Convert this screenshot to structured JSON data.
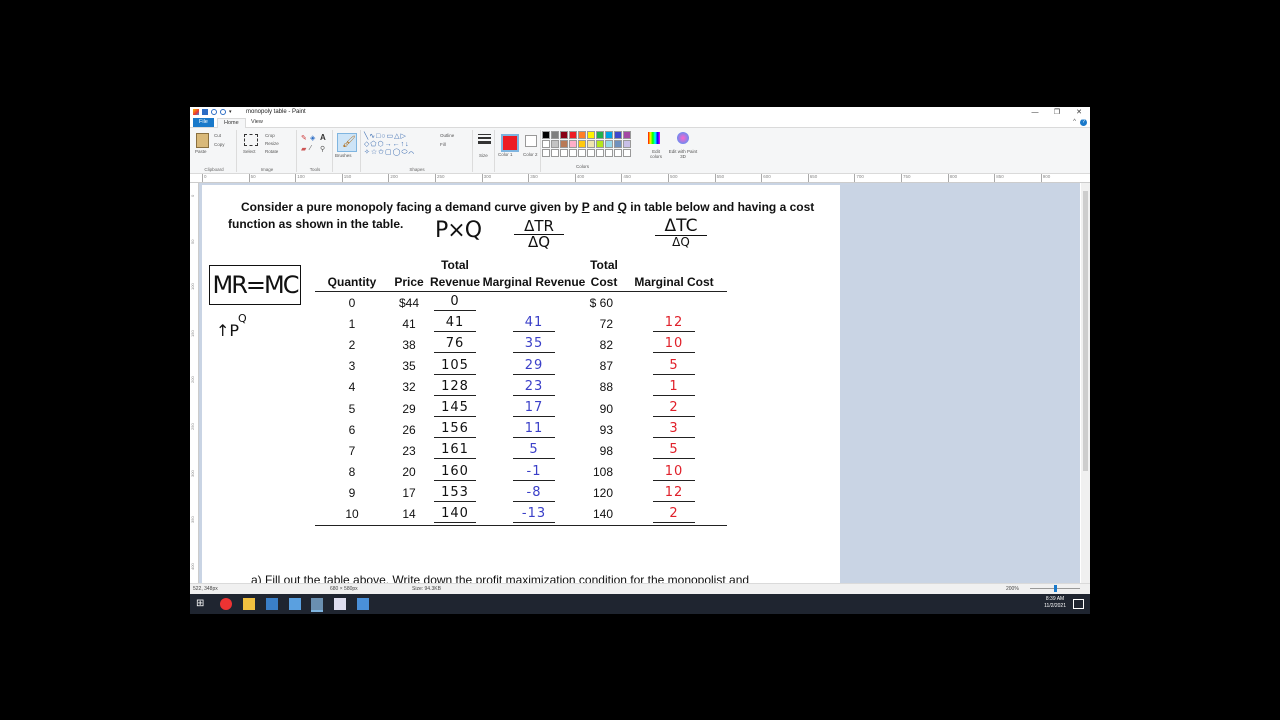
{
  "window": {
    "title": "monopoly table - Paint",
    "tabs": [
      "File",
      "Home",
      "View"
    ],
    "help": "?"
  },
  "ribbon": {
    "clipboard": {
      "label": "Clipboard",
      "paste": "Paste",
      "cut": "Cut",
      "copy": "Copy"
    },
    "image": {
      "label": "Image",
      "select": "Select",
      "crop": "Crop",
      "resize": "Resize",
      "rotate": "Rotate"
    },
    "tools": {
      "label": "Tools"
    },
    "brushes": {
      "label": "Brushes"
    },
    "shapes": {
      "label": "Shapes",
      "outline": "Outline",
      "fill": "Fill"
    },
    "size": {
      "label": "Size"
    },
    "color1": {
      "label": "Color 1"
    },
    "color2": {
      "label": "Color 2"
    },
    "colors": {
      "label": "Colors"
    },
    "edit_colors": "Edit colors",
    "edit_paint3d": "Edit with Paint 3D",
    "palette": [
      "#000000",
      "#7f7f7f",
      "#880015",
      "#ed1c24",
      "#ff7f27",
      "#fff200",
      "#22b14c",
      "#00a2e8",
      "#3f48cc",
      "#a349a4",
      "#ffffff",
      "#c3c3c3",
      "#b97a57",
      "#ffaec9",
      "#ffc90e",
      "#efe4b0",
      "#b5e61d",
      "#99d9ea",
      "#7092be",
      "#c8bfe7",
      "#ffffff",
      "#ffffff",
      "#ffffff",
      "#ffffff",
      "#ffffff",
      "#ffffff",
      "#ffffff",
      "#ffffff",
      "#ffffff",
      "#ffffff"
    ],
    "active_color": "#ed1c24"
  },
  "ruler_h": [
    "0",
    "50",
    "100",
    "150",
    "200",
    "250",
    "300",
    "350",
    "400",
    "450",
    "500",
    "550",
    "600",
    "650",
    "700",
    "750",
    "800",
    "850",
    "900"
  ],
  "ruler_v": [
    "0",
    "50",
    "100",
    "150",
    "200",
    "250",
    "300",
    "350",
    "400"
  ],
  "document": {
    "intro_line1_a": "Consider a pure monopoly facing a demand curve given by ",
    "intro_p": "P",
    "intro_and": " and ",
    "intro_q": "Q",
    "intro_line1_b": " in table below and  having a cost",
    "intro_line2": "function as shown in the table.",
    "annotations": {
      "pxq": "P×Q",
      "dtr_top": "ΔTR",
      "dtr_bottom": "ΔQ",
      "dtc_top": "ΔTC",
      "dtc_bottom": "ΔQ",
      "mr_mc": "MR=MC",
      "arrow_pq": "↑P",
      "q_super": "Q"
    },
    "headers": [
      "Quantity",
      "Price",
      "Total Revenue",
      "Marginal Revenue",
      "Total Cost",
      "Marginal Cost"
    ],
    "rows": [
      {
        "q": "0",
        "p": "$44",
        "tr": "0",
        "mr": "",
        "tc": "$  60",
        "mc": ""
      },
      {
        "q": "1",
        "p": "41",
        "tr": "41",
        "mr": "41",
        "tc": "72",
        "mc": "12"
      },
      {
        "q": "2",
        "p": "38",
        "tr": "76",
        "mr": "35",
        "tc": "82",
        "mc": "10"
      },
      {
        "q": "3",
        "p": "35",
        "tr": "105",
        "mr": "29",
        "tc": "87",
        "mc": "5"
      },
      {
        "q": "4",
        "p": "32",
        "tr": "128",
        "mr": "23",
        "tc": "88",
        "mc": "1"
      },
      {
        "q": "5",
        "p": "29",
        "tr": "145",
        "mr": "17",
        "tc": "90",
        "mc": "2"
      },
      {
        "q": "6",
        "p": "26",
        "tr": "156",
        "mr": "11",
        "tc": "93",
        "mc": "3"
      },
      {
        "q": "7",
        "p": "23",
        "tr": "161",
        "mr": "5",
        "tc": "98",
        "mc": "5"
      },
      {
        "q": "8",
        "p": "20",
        "tr": "160",
        "mr": "-1",
        "tc": "108",
        "mc": "10"
      },
      {
        "q": "9",
        "p": "17",
        "tr": "153",
        "mr": "-8",
        "tc": "120",
        "mc": "12"
      },
      {
        "q": "10",
        "p": "14",
        "tr": "140",
        "mr": "-13",
        "tc": "140",
        "mc": "2"
      }
    ],
    "footer": "a)   Fill out the table above. Write down the profit maximization condition for the monopolist and"
  },
  "status": {
    "cursor": "522, 348px",
    "selection": "",
    "dimensions": "680 × 580px",
    "size": "Size: 94.3KB",
    "zoom": "200%"
  },
  "taskbar": {
    "time": "8:39 AM",
    "date": "11/2/2021"
  }
}
